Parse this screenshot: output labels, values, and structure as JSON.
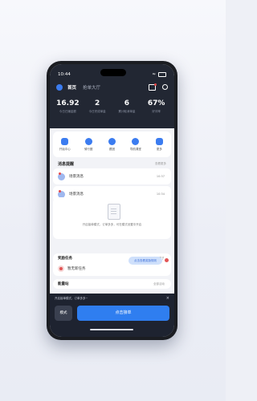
{
  "status": {
    "time": "10:44"
  },
  "nav": {
    "tabs": [
      "首页",
      "抢单大厅"
    ]
  },
  "stats": [
    {
      "value": "16.92",
      "label": "今日已赚金额"
    },
    {
      "value": "2",
      "label": "今日完成单量"
    },
    {
      "value": "6",
      "label": "累计取消单量"
    },
    {
      "value": "67%",
      "label": "好评率"
    }
  ],
  "quick": [
    {
      "label": "开始中心",
      "icon": "bell-icon"
    },
    {
      "label": "骑行圈",
      "icon": "scooter-icon"
    },
    {
      "label": "跟团",
      "icon": "location-icon"
    },
    {
      "label": "导航课堂",
      "icon": "map-icon"
    },
    {
      "label": "更多",
      "icon": "grid-icon"
    }
  ],
  "messages": {
    "title": "消息提醒",
    "more": "查看更多",
    "items": [
      {
        "text": "场景消息",
        "time": "10:37"
      },
      {
        "text": "场景消息",
        "time": "10:34"
      }
    ]
  },
  "empty_text": "开启接单模式，订单多多，可在模式设置中开启",
  "task": {
    "title": "奖励任务",
    "more": "查看更多",
    "item": "暂无新任务",
    "bubble": "点击查看奖励规则"
  },
  "energy": {
    "title": "能量站",
    "more": "全部活动"
  },
  "bottom": {
    "tip": "开启接单模式，订单多多~",
    "mode_label": "模式",
    "grab_label": "点击接单"
  },
  "colors": {
    "accent": "#2f7ef0",
    "dark": "#222733",
    "alert": "#e25555"
  }
}
